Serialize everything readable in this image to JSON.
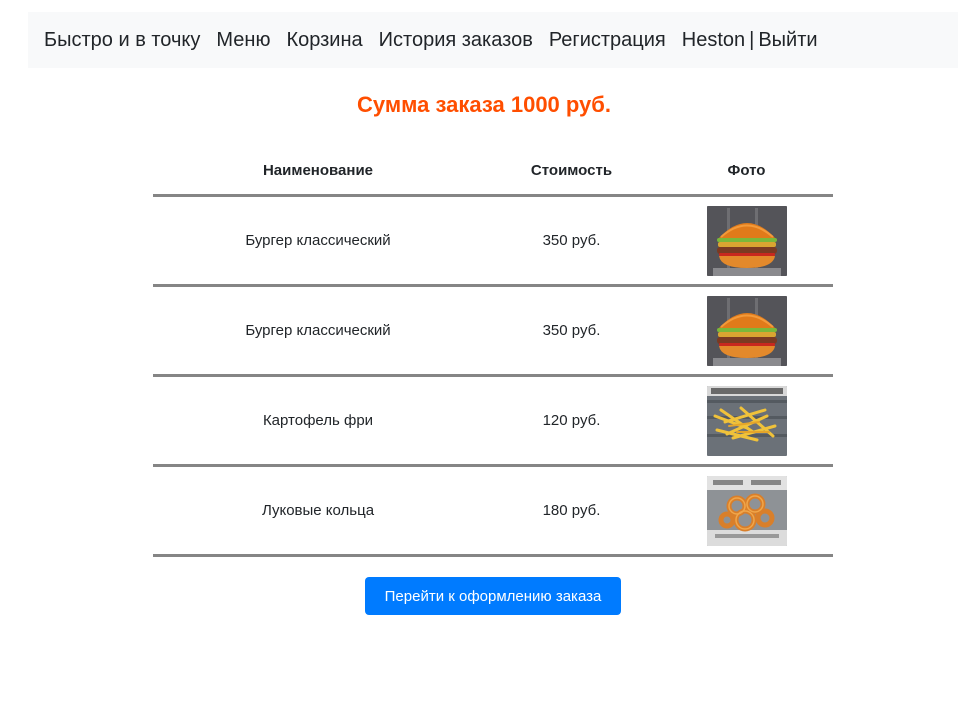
{
  "nav": {
    "brand": "Быстро и в точку",
    "menu": "Меню",
    "cart": "Корзина",
    "history": "История заказов",
    "register": "Регистрация",
    "user": "Heston",
    "separator": "|",
    "logout": "Выйти"
  },
  "order": {
    "title": "Сумма заказа 1000 руб.",
    "headers": {
      "name": "Наименование",
      "price": "Стоимость",
      "photo": "Фото"
    },
    "items": [
      {
        "name": "Бургер классический",
        "price": "350 руб.",
        "photo_icon": "burger-photo"
      },
      {
        "name": "Бургер классический",
        "price": "350 руб.",
        "photo_icon": "burger-photo"
      },
      {
        "name": "Картофель фри",
        "price": "120 руб.",
        "photo_icon": "fries-photo"
      },
      {
        "name": "Луковые кольца",
        "price": "180 руб.",
        "photo_icon": "onion-rings-photo"
      }
    ],
    "checkout_label": "Перейти к оформлению заказа"
  },
  "colors": {
    "accent": "#ff4e00",
    "primary_button": "#007bff",
    "navbar_bg": "#f8f9fa",
    "row_border": "#858585"
  }
}
